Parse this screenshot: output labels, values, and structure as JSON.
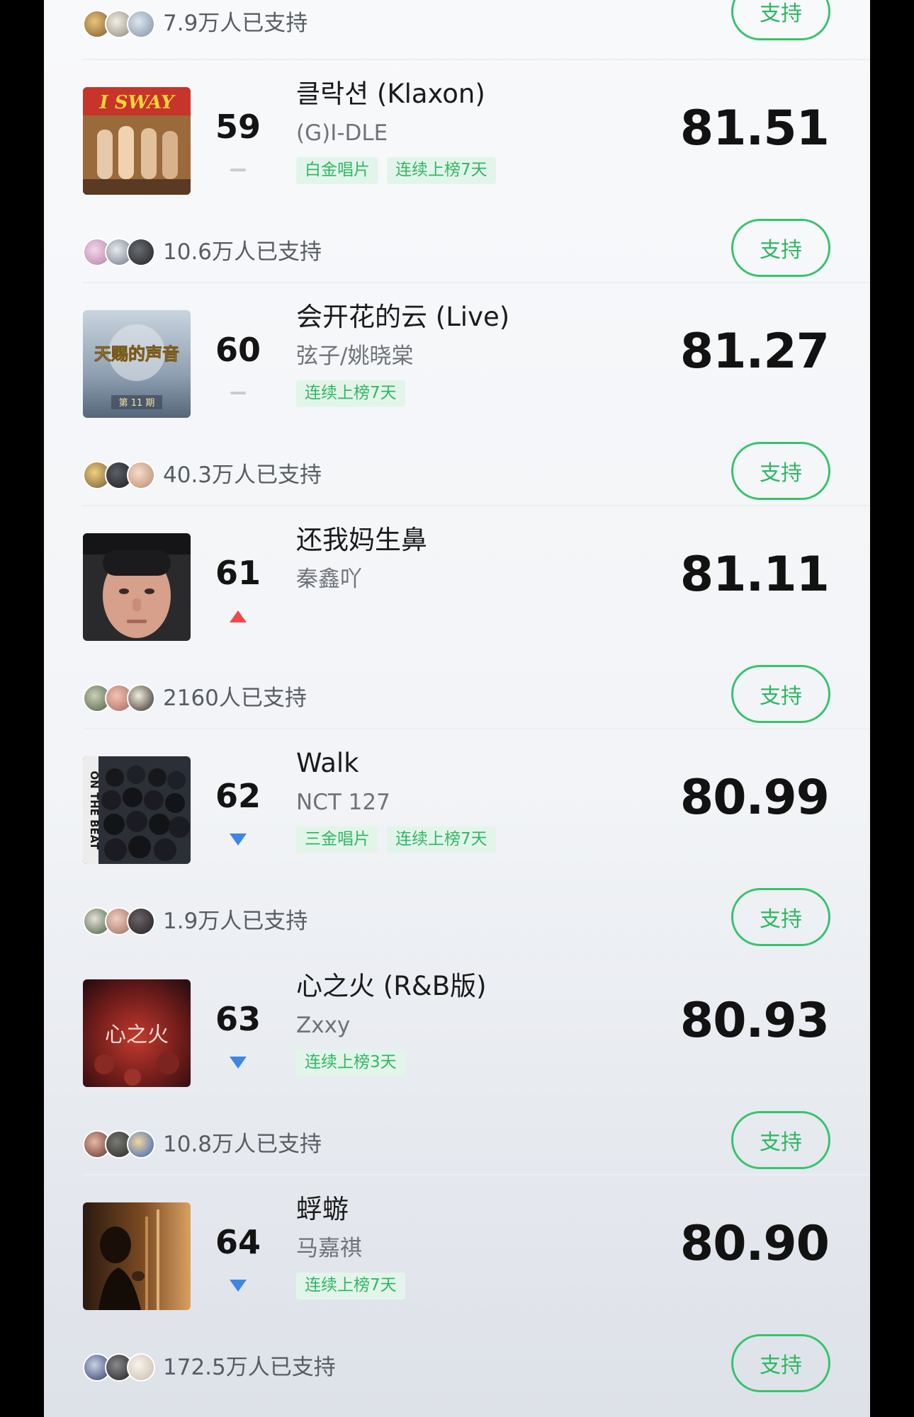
{
  "top_partial": {
    "supporters": "7.9万人已支持",
    "support_label": "支持"
  },
  "songs": [
    {
      "rank": "59",
      "trend": "flat",
      "title": "클락션 (Klaxon)",
      "artist": "(G)I-DLE",
      "tags": [
        "白金唱片",
        "连续上榜7天"
      ],
      "score": "81.51",
      "supporters": "10.6万人已支持",
      "support_label": "支持",
      "cover_text": "I SWAY"
    },
    {
      "rank": "60",
      "trend": "flat",
      "title": "会开花的云 (Live)",
      "artist": "弦子/姚晓棠",
      "tags": [
        "连续上榜7天"
      ],
      "score": "81.27",
      "supporters": "40.3万人已支持",
      "support_label": "支持",
      "cover_text": "天赐的声音",
      "cover_subtext": "第 11 期"
    },
    {
      "rank": "61",
      "trend": "up",
      "title": "还我妈生鼻",
      "artist": "秦鑫吖",
      "tags": [],
      "score": "81.11",
      "supporters": "2160人已支持",
      "support_label": "支持"
    },
    {
      "rank": "62",
      "trend": "down",
      "title": "Walk",
      "artist": "NCT 127",
      "tags": [
        "三金唱片",
        "连续上榜7天"
      ],
      "score": "80.99",
      "supporters": "1.9万人已支持",
      "support_label": "支持",
      "cover_text": "ON THE BEAT"
    },
    {
      "rank": "63",
      "trend": "down",
      "title": "心之火 (R&B版)",
      "artist": "Zxxy",
      "tags": [
        "连续上榜3天"
      ],
      "score": "80.93",
      "supporters": "10.8万人已支持",
      "support_label": "支持",
      "cover_text": "心之火"
    },
    {
      "rank": "64",
      "trend": "down",
      "title": "蜉蝣",
      "artist": "马嘉祺",
      "tags": [
        "连续上榜7天"
      ],
      "score": "80.90",
      "supporters": "172.5万人已支持",
      "support_label": "支持"
    }
  ],
  "colors": {
    "accent_green": "#35c46d",
    "tag_bg": "#e3f5ea",
    "trend_up": "#f0484c",
    "trend_down": "#3e86e6"
  }
}
